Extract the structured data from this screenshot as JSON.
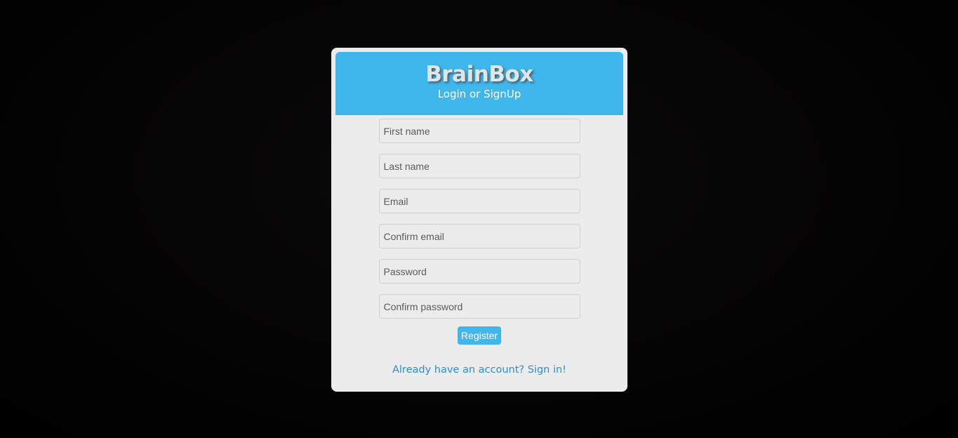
{
  "header": {
    "title": "BrainBox",
    "subtitle": "Login or SignUp"
  },
  "form": {
    "first_name_placeholder": "First name",
    "last_name_placeholder": "Last name",
    "email_placeholder": "Email",
    "confirm_email_placeholder": "Confirm email",
    "password_placeholder": "Password",
    "confirm_password_placeholder": "Confirm password",
    "register_label": "Register"
  },
  "footer": {
    "signin_link": "Already have an account? Sign in!"
  },
  "colors": {
    "accent": "#3fb6ec",
    "card_background": "#ececec",
    "link": "#2a8fd3",
    "page_background": "#000000"
  }
}
